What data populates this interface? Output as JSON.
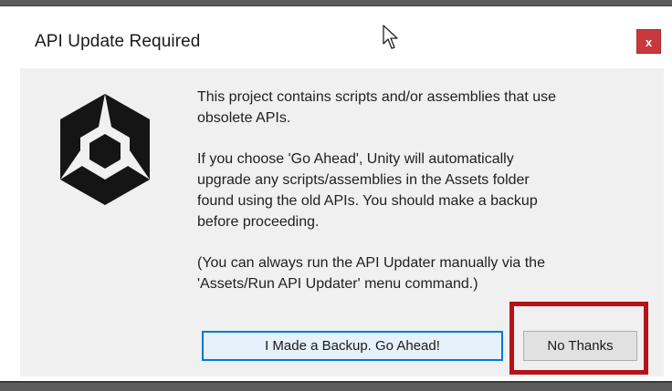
{
  "dialog": {
    "title": "API Update Required",
    "close_label": "x",
    "paragraphs": [
      "This project contains scripts and/or assemblies that use\nobsolete APIs.",
      "If you choose 'Go Ahead', Unity will automatically\nupgrade any scripts/assemblies in the Assets folder\nfound using the old APIs. You should make a backup\nbefore proceeding.",
      "(You can always run the API Updater manually via the\n'Assets/Run API Updater' menu command.)"
    ],
    "buttons": {
      "primary_label": "I Made a Backup. Go Ahead!",
      "secondary_label": "No Thanks"
    }
  },
  "icons": {
    "logo": "unity-logo-icon",
    "cursor": "mouse-pointer-icon"
  },
  "colors": {
    "close_button": "#c9383d",
    "primary_button_border": "#0078d7",
    "highlight_box": "#b5121b"
  }
}
